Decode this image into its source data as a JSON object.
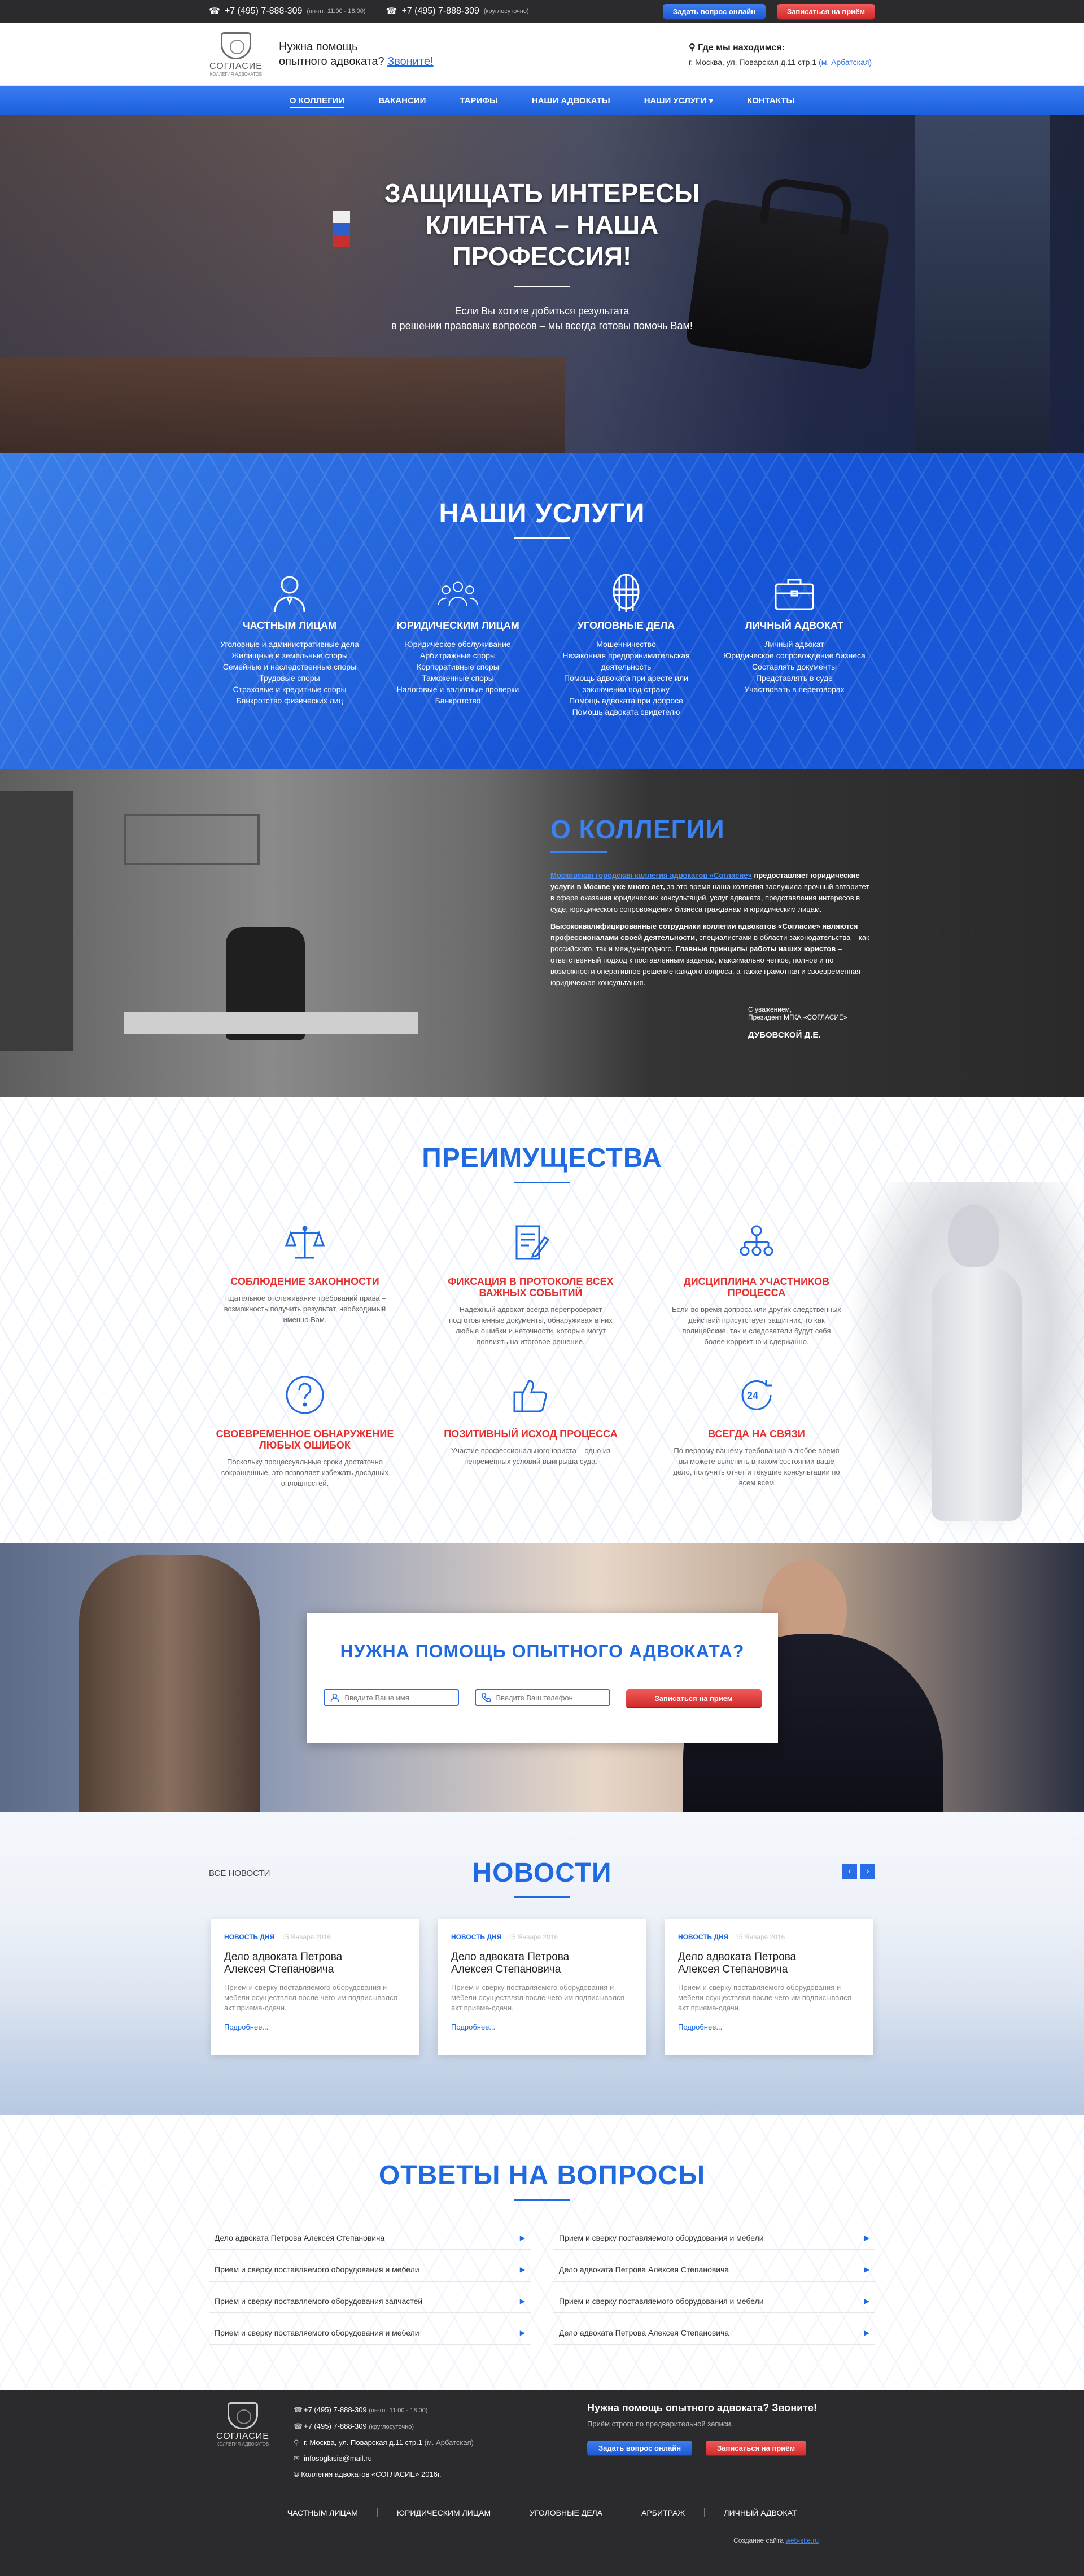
{
  "topbar": {
    "phone1": "+7 (495) 7-888-309",
    "phone1_note": "(пн-пт: 11:00 - 18:00)",
    "phone2": "+7 (495) 7-888-309",
    "phone2_note": "(круглосуточно)",
    "ask_btn": "Задать вопрос онлайн",
    "appoint_btn": "Записаться на приём"
  },
  "header": {
    "logo_title": "СОГЛАСИЕ",
    "logo_sub": "КОЛЛЕГИЯ АДВОКАТОВ",
    "help_line1": "Нужна помощь",
    "help_line2": "опытного адвоката?",
    "help_call": "Звоните!",
    "addr_title": "Где мы находимся:",
    "addr_text": "г. Москва, ул. Поварская д.11 стр.1",
    "addr_metro": "(м. Арбатская)"
  },
  "nav": [
    "О КОЛЛЕГИИ",
    "ВАКАНСИИ",
    "ТАРИФЫ",
    "НАШИ АДВОКАТЫ",
    "НАШИ УСЛУГИ",
    "КОНТАКТЫ"
  ],
  "hero": {
    "title": "ЗАЩИЩАТЬ ИНТЕРЕСЫ КЛИЕНТА – НАША ПРОФЕССИЯ!",
    "sub1": "Если Вы хотите добиться результата",
    "sub2": "в решении правовых вопросов – мы всегда готовы помочь Вам!"
  },
  "services": {
    "title": "НАШИ УСЛУГИ",
    "items": [
      {
        "title": "ЧАСТНЫМ ЛИЦАМ",
        "icon": "person-icon",
        "list": [
          "Уголовные и административные дела",
          "Жилищные и земельные споры",
          "Семейные и наследственные споры",
          "Трудовые споры",
          "Страховые и кредитные споры",
          "Банкротство физических лиц"
        ]
      },
      {
        "title": "ЮРИДИЧЕСКИМ ЛИЦАМ",
        "icon": "group-icon",
        "list": [
          "Юридическое обслуживание",
          "Арбитражные споры",
          "Корпоративные споры",
          "Таможенные споры",
          "Налоговые и валютные проверки",
          "Банкротство"
        ]
      },
      {
        "title": "УГОЛОВНЫЕ ДЕЛА",
        "icon": "prisoner-icon",
        "list": [
          "Мошенничество",
          "Незаконная предпринимательская деятельность",
          "Помощь адвоката при аресте или заключении под стражу",
          "Помощь адвоката при допросе",
          "Помощь адвоката свидетелю"
        ]
      },
      {
        "title": "ЛИЧНЫЙ АДВОКАТ",
        "icon": "briefcase-icon",
        "list": [
          "Личный адвокат",
          "Юридическое сопровождение бизнеса",
          "Составлять документы",
          "Представлять в суде",
          "Участвовать в переговорах"
        ]
      }
    ]
  },
  "about": {
    "title": "О КОЛЛЕГИИ",
    "p1_hl": "Московская городская коллегия адвокатов «Согласие»",
    "p1_bold": " предоставляет юридические услуги в Москве уже много лет,",
    "p1_rest": " за это время наша коллегия заслужила прочный авторитет в сфере оказания юридических консультаций, услуг адвоката, представления интересов в суде, юридического сопровождения бизнеса гражданам и юридическим лицам.",
    "p2_bold": "Высококвалифицированные сотрудники коллегии адвокатов «Согласие» являются профессионалами своей деятельности,",
    "p2_mid": " специалистами в области законодательства – как российского, так и международного.",
    "p2_bold2": " Главные принципы работы наших юристов",
    "p2_rest": " – ответственный подход к поставленным задачам, максимально четкое, полное и по возможности оперативное решение каждого вопроса, а также грамотная и своевременная юридическая консультация.",
    "sign_regards": "С уважением,",
    "sign_role": "Президент МГКА «СОГЛАСИЕ»",
    "sign_name": "ДУБОВСКОЙ Д.Е."
  },
  "benefits": {
    "title": "ПРЕИМУЩЕСТВА",
    "items": [
      {
        "icon": "scales-icon",
        "title": "СОБЛЮДЕНИЕ ЗАКОННОСТИ",
        "text": "Тщательное отслеживание требований права – возможность получить результат, необходимый именно Вам."
      },
      {
        "icon": "document-pen-icon",
        "title": "ФИКСАЦИЯ В ПРОТОКОЛЕ ВСЕХ ВАЖНЫХ СОБЫТИЙ",
        "text": "Надежный адвокат всегда перепроверяет подготовленные документы, обнаруживая в них любые ошибки и неточности, которые могут повлиять на итоговое решение."
      },
      {
        "icon": "hierarchy-icon",
        "title": "ДИСЦИПЛИНА УЧАСТНИКОВ ПРОЦЕССА",
        "text": "Если во время допроса или других следственных действий присутствует защитник, то как полицейские, так и следователи будут себя более корректно и сдержанно."
      },
      {
        "icon": "question-icon",
        "title": "СВОЕВРЕМЕННОЕ ОБНАРУЖЕНИЕ ЛЮБЫХ ОШИБОК",
        "text": "Поскольку процессуальные сроки достаточно сокращенные, это позволяет избежать досадных оплошностей."
      },
      {
        "icon": "thumbs-up-icon",
        "title": "ПОЗИТИВНЫЙ ИСХОД ПРОЦЕССА",
        "text": "Участие профессионального юриста – одно из непременных условий выигрыша суда."
      },
      {
        "icon": "24h-icon",
        "title": "ВСЕГДА НА СВЯЗИ",
        "text": "По первому вашему требованию в любое время вы можете выяснить в каком состоянии ваше дело, получить отчет и текущие консультации по всем всем"
      }
    ]
  },
  "cta": {
    "title": "НУЖНА ПОМОЩЬ ОПЫТНОГО АДВОКАТА?",
    "name_placeholder": "Введите Ваше имя",
    "phone_placeholder": "Введите Ваш телефон",
    "submit": "Записаться на прием"
  },
  "news": {
    "title": "НОВОСТИ",
    "all": "ВСЕ НОВОСТИ",
    "items": [
      {
        "tag": "НОВОСТЬ ДНЯ",
        "date": "15 Января 2016",
        "title": "Дело адвоката Петрова Алексея Степановича",
        "text": "Прием и сверку поставляемого оборудования и мебели осуществлял после чего им подписывался акт приема-сдачи.",
        "more": "Подробнее..."
      },
      {
        "tag": "НОВОСТЬ ДНЯ",
        "date": "15 Января 2016",
        "title": "Дело адвоката Петрова Алексея Степановича",
        "text": "Прием и сверку поставляемого оборудования и мебели осуществлял после чего им подписывался акт приема-сдачи.",
        "more": "Подробнее..."
      },
      {
        "tag": "НОВОСТЬ ДНЯ",
        "date": "15 Января 2016",
        "title": "Дело адвоката Петрова Алексея Степановича",
        "text": "Прием и сверку поставляемого оборудования и мебели осуществлял после чего им подписывался акт приема-сдачи.",
        "more": "Подробнее..."
      }
    ]
  },
  "faq": {
    "title": "ОТВЕТЫ НА ВОПРОСЫ",
    "items": [
      "Дело адвоката Петрова Алексея Степановича",
      "Прием и сверку поставляемого оборудования и мебели",
      "Прием и сверку поставляемого оборудования и мебели",
      "Дело адвоката Петрова Алексея Степановича",
      "Прием и сверку поставляемого оборудования запчастей",
      "Прием и сверку поставляемого оборудования и мебели",
      "Прием и сверку поставляемого оборудования и мебели",
      "Дело адвоката Петрова Алексея Степановича"
    ]
  },
  "footer": {
    "phone1": "+7 (495) 7-888-309",
    "phone1_note": "(пн-пт: 11:00 - 18:00)",
    "phone2": "+7 (495) 7-888-309",
    "phone2_note": "(круглосуточно)",
    "address": "г. Москва, ул. Поварская д.11 стр.1",
    "metro": "(м. Арбатская)",
    "email": "infosoglasie@mail.ru",
    "copyright": "© Коллегия адвокатов «СОГЛАСИЕ» 2016г.",
    "cta_title": "Нужна помощь опытного адвоката? Звоните!",
    "cta_sub": "Приём строго по предварительной записи.",
    "ask_btn": "Задать вопрос онлайн",
    "appoint_btn": "Записаться на приём",
    "nav": [
      "ЧАСТНЫМ ЛИЦАМ",
      "ЮРИДИЧЕСКИМ ЛИЦАМ",
      "УГОЛОВНЫЕ ДЕЛА",
      "АРБИТРАЖ",
      "ЛИЧНЫЙ АДВОКАТ"
    ],
    "made_label": "Создание сайта",
    "made_link": "web-site.ru"
  }
}
